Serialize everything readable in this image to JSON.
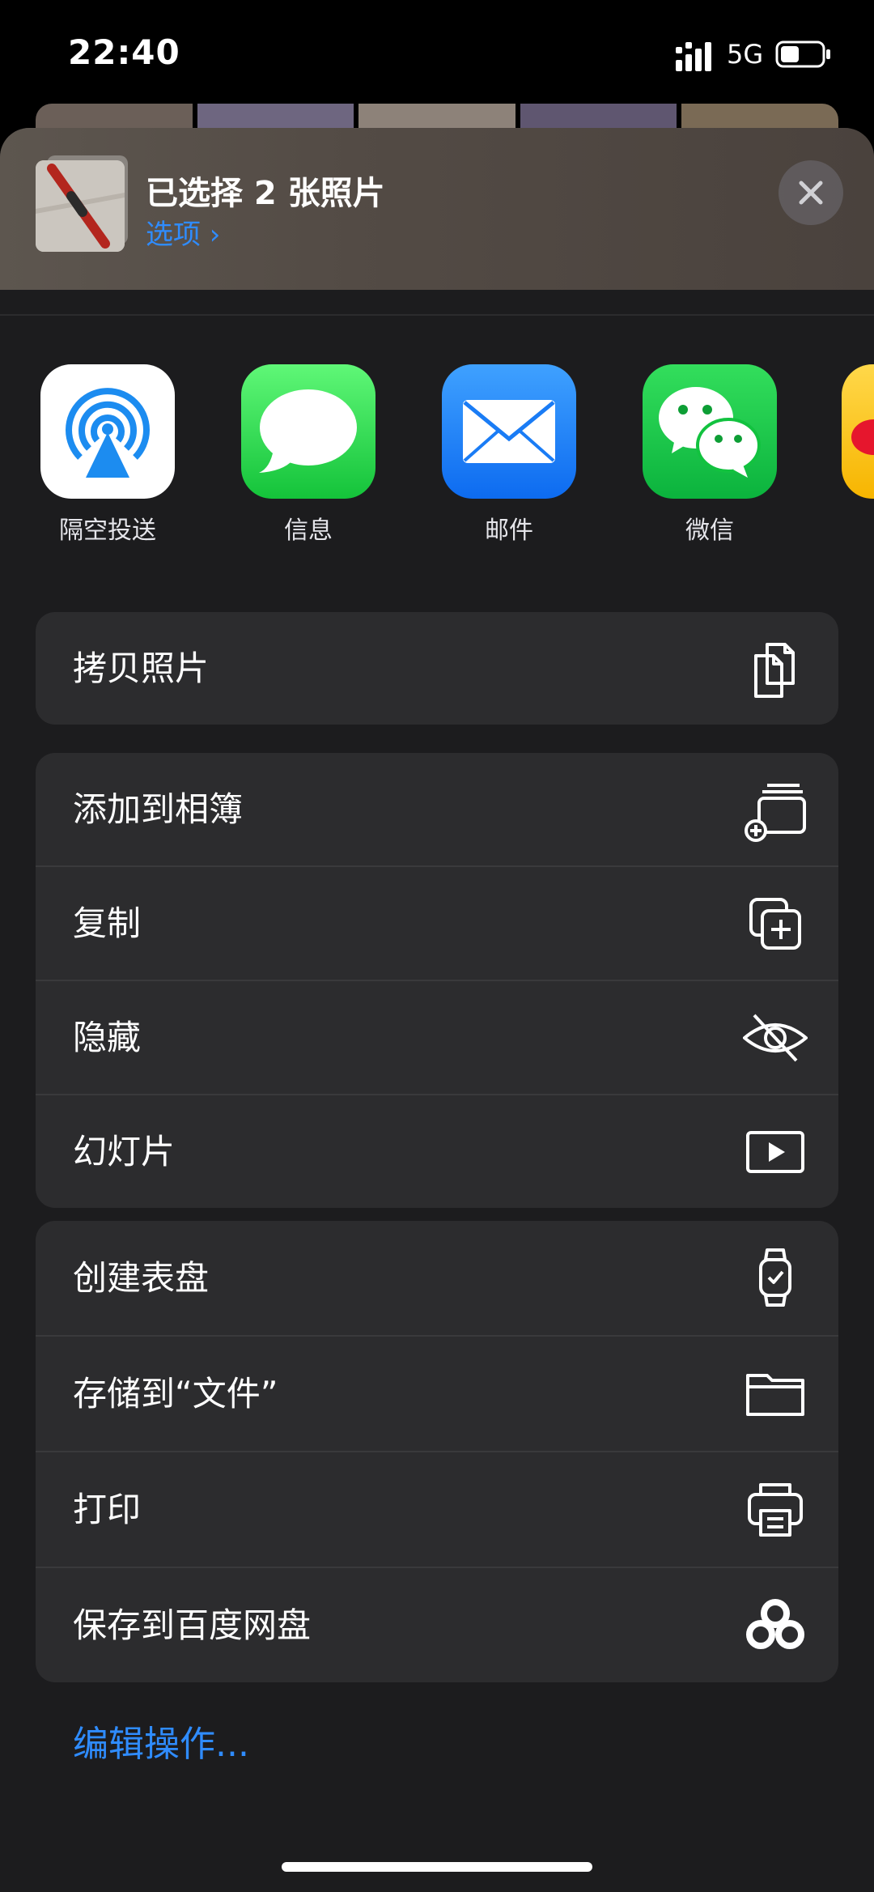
{
  "status_bar": {
    "time": "22:40",
    "network": "5G"
  },
  "share_header": {
    "title": "已选择 2 张照片",
    "options_label": "选项 ›"
  },
  "apps": [
    {
      "label": "隔空投送",
      "icon": "airdrop-icon"
    },
    {
      "label": "信息",
      "icon": "messages-icon"
    },
    {
      "label": "邮件",
      "icon": "mail-icon"
    },
    {
      "label": "微信",
      "icon": "wechat-icon"
    }
  ],
  "actions": {
    "group1": [
      {
        "label": "拷贝照片",
        "icon": "copy-photos-icon"
      }
    ],
    "group2": [
      {
        "label": "添加到相簿",
        "icon": "add-to-album-icon"
      },
      {
        "label": "复制",
        "icon": "duplicate-icon"
      },
      {
        "label": "隐藏",
        "icon": "hide-eye-icon"
      },
      {
        "label": "幻灯片",
        "icon": "slideshow-icon"
      }
    ],
    "group3": [
      {
        "label": "创建表盘",
        "icon": "watch-face-icon"
      },
      {
        "label": "存储到“文件”",
        "icon": "folder-icon"
      },
      {
        "label": "打印",
        "icon": "printer-icon"
      },
      {
        "label": "保存到百度网盘",
        "icon": "baidu-netdisk-icon"
      }
    ]
  },
  "edit_actions_label": "编辑操作...",
  "colors": {
    "accent": "#2f8cff",
    "sheet": "#1c1c1e",
    "row": "#2c2c2e"
  }
}
